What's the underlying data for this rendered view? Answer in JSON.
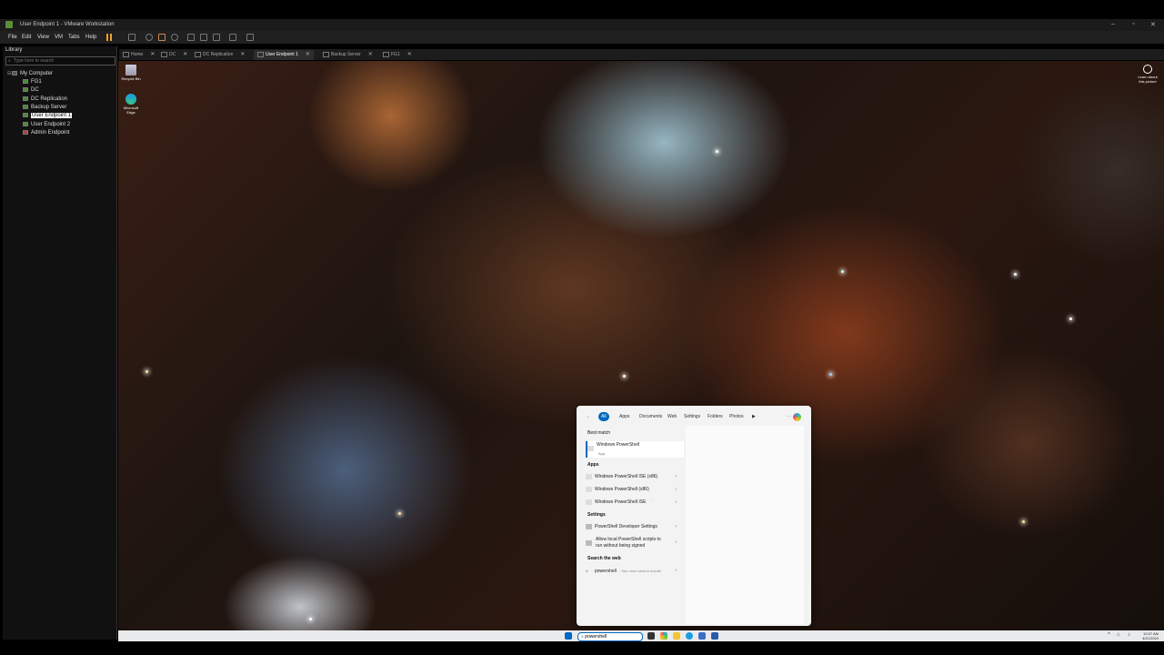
{
  "window": {
    "title": "User Endpoint 1 - VMware Workstation"
  },
  "menu": {
    "items": [
      "File",
      "Edit",
      "View",
      "VM",
      "Tabs",
      "Help"
    ]
  },
  "library": {
    "title": "Library",
    "search_placeholder": "Type here to search",
    "root": "My Computer",
    "vms": [
      {
        "name": "FG1",
        "status": "running"
      },
      {
        "name": "DC",
        "status": "running"
      },
      {
        "name": "DC Replication",
        "status": "running"
      },
      {
        "name": "Backup Server",
        "status": "running"
      },
      {
        "name": "User Endpoint 1",
        "status": "running",
        "selected": true
      },
      {
        "name": "User Endpoint 2",
        "status": "running"
      },
      {
        "name": "Admin Endpoint",
        "status": "stopped"
      }
    ]
  },
  "tabs": [
    {
      "label": "Home"
    },
    {
      "label": "DC"
    },
    {
      "label": "DC Replication"
    },
    {
      "label": "User Endpoint 1",
      "active": true
    },
    {
      "label": "Backup Server"
    },
    {
      "label": "FG1"
    }
  ],
  "desktop": {
    "icons": [
      {
        "label": "Recycle Bin"
      },
      {
        "label": "Microsoft Edge"
      }
    ],
    "learn_label": "Learn about this picture"
  },
  "search_panel": {
    "filters": [
      "All",
      "Apps",
      "Documents",
      "Web",
      "Settings",
      "Folders",
      "Photos"
    ],
    "best_match_title": "Best match",
    "best_match": {
      "name": "Windows PowerShell",
      "type": "App"
    },
    "apps_title": "Apps",
    "apps": [
      "Windows PowerShell ISE (x86)",
      "Windows PowerShell (x86)",
      "Windows PowerShell ISE"
    ],
    "settings_title": "Settings",
    "settings": [
      "PowerShell Developer Settings",
      "Allow local PowerShell scripts to run without being signed"
    ],
    "web_title": "Search the web",
    "web": {
      "query": "powershell",
      "hint": "- See more search results"
    }
  },
  "taskbar": {
    "search_value": "powershell",
    "clock_time": "12:07 AM",
    "clock_date": "4/21/2024"
  },
  "colors": {
    "accent": "#0067c0",
    "vm_running": "#4c8a3c",
    "vm_stopped": "#b04040"
  }
}
